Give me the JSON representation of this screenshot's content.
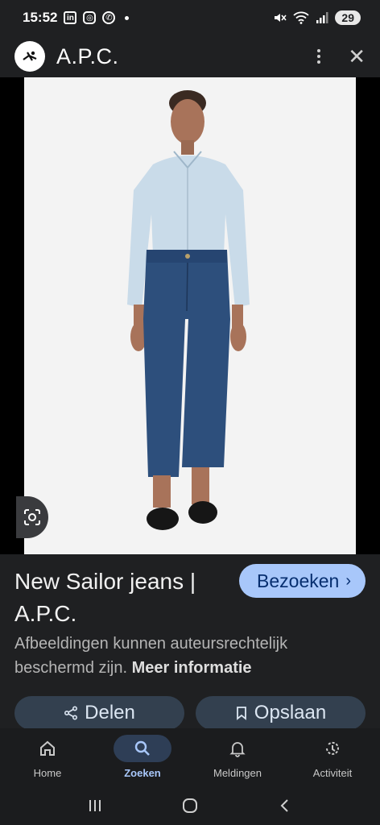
{
  "status": {
    "time": "15:52",
    "battery": "29"
  },
  "appbar": {
    "title": "A.P.C."
  },
  "product": {
    "title": "New Sailor jeans | A.P.C.",
    "visit_label": "Bezoeken",
    "disclaimer": "Afbeeldingen kunnen auteursrechtelijk beschermd zijn.",
    "more_info": "Meer informatie"
  },
  "actions": {
    "share_label": "Delen",
    "save_label": "Opslaan"
  },
  "nav": {
    "items": [
      {
        "label": "Home",
        "icon": "home-icon"
      },
      {
        "label": "Zoeken",
        "icon": "search-icon",
        "active": true
      },
      {
        "label": "Meldingen",
        "icon": "bell-icon"
      },
      {
        "label": "Activiteit",
        "icon": "history-icon"
      }
    ]
  },
  "colors": {
    "accent": "#a8c7fa",
    "background": "#1f2022",
    "pill": "#33404f"
  }
}
